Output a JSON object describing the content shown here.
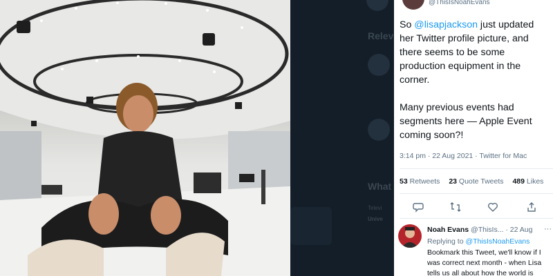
{
  "photo": {
    "description_icon": "photo-of-woman-in-studio"
  },
  "backdrop": {
    "ghost_relevant": "Relev",
    "ghost_whats": "What",
    "ghost_line1": "Televi",
    "ghost_line2": "Unive"
  },
  "tweet": {
    "handle": "@ThisIsNoahEvans",
    "text_prefix": "So ",
    "mention": "@lisapjackson",
    "text_suffix": " just updated her Twitter profile picture, and there seems to be some production equipment in the corner.",
    "text_para2": "Many previous events had segments here — Apple Event coming soon?!",
    "meta": "3:14 pm · 22 Aug 2021 · Twitter for Mac",
    "stats": [
      {
        "count": "53",
        "label": "Retweets"
      },
      {
        "count": "23",
        "label": "Quote Tweets"
      },
      {
        "count": "489",
        "label": "Likes"
      }
    ],
    "actions": [
      "reply-icon",
      "retweet-icon",
      "like-icon",
      "share-icon"
    ]
  },
  "reply": {
    "name": "Noah Evans",
    "handle": "@ThisIs...",
    "date": "· 22 Aug",
    "more": "···",
    "replying_prefix": "Replying to ",
    "replying_handle": "@ThisIsNoahEvans",
    "text": "Bookmark this Tweet, we'll know if I was correct next month - when Lisa tells us all about how the world is"
  },
  "colors": {
    "link": "#1d9bf0",
    "text": "#0f1419",
    "muted": "#5b7083",
    "dark_bg": "#15202b"
  }
}
